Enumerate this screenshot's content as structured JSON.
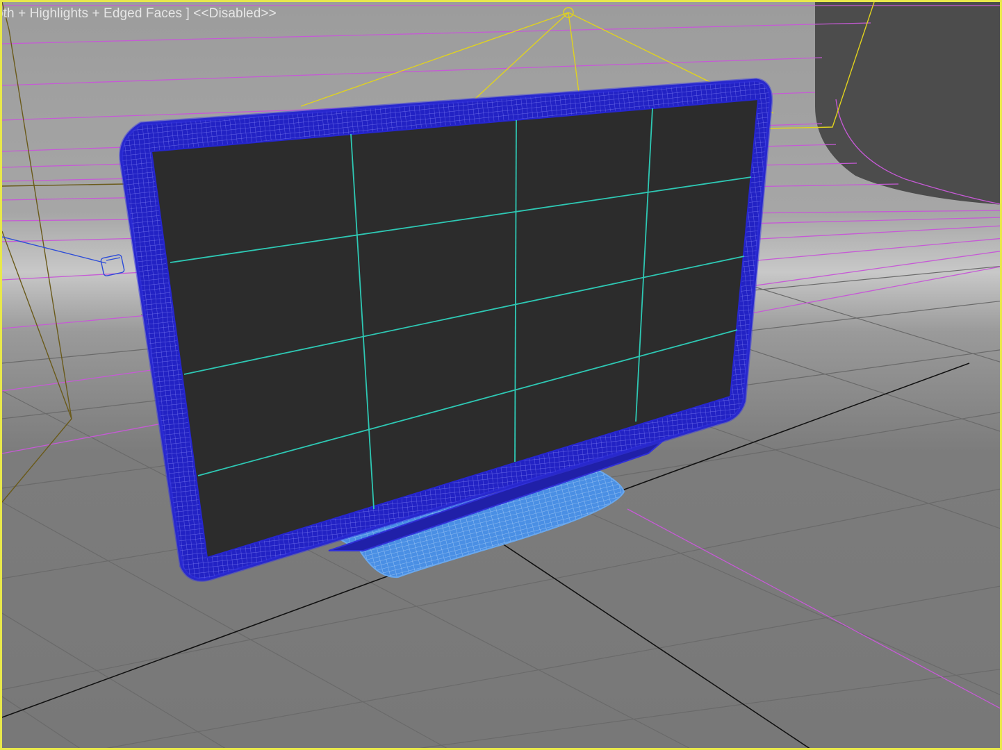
{
  "viewport": {
    "label": "oth + Highlights + Edged Faces ] <<Disabled>>",
    "active": true
  },
  "colors": {
    "background_top": "#9a9a9a",
    "background_mid": "#8a8a8a",
    "floor": "#7b7b7b",
    "grid_line": "#6c6c6c",
    "home_grid_axis": "#101010",
    "active_border": "#e8e84a",
    "selected_mesh": "#2424c8",
    "stand_mesh": "#3a8ae6",
    "screen_face": "#2c2c2c",
    "screen_edges": "#2ec8b4",
    "backdrop_wire": "#c65ad6",
    "light_wire": "#e0d21e",
    "camera_wire": "#6a5a1a",
    "target_wire": "#2c4cd8"
  },
  "objects": [
    {
      "name": "tv-screen",
      "kind": "mesh",
      "selected": true
    },
    {
      "name": "tv-stand",
      "kind": "mesh",
      "selected": true
    },
    {
      "name": "backdrop",
      "kind": "mesh",
      "selected": false
    },
    {
      "name": "light",
      "kind": "light",
      "selected": false
    },
    {
      "name": "camera",
      "kind": "camera",
      "selected": false
    },
    {
      "name": "camera-target",
      "kind": "helper",
      "selected": false
    }
  ]
}
